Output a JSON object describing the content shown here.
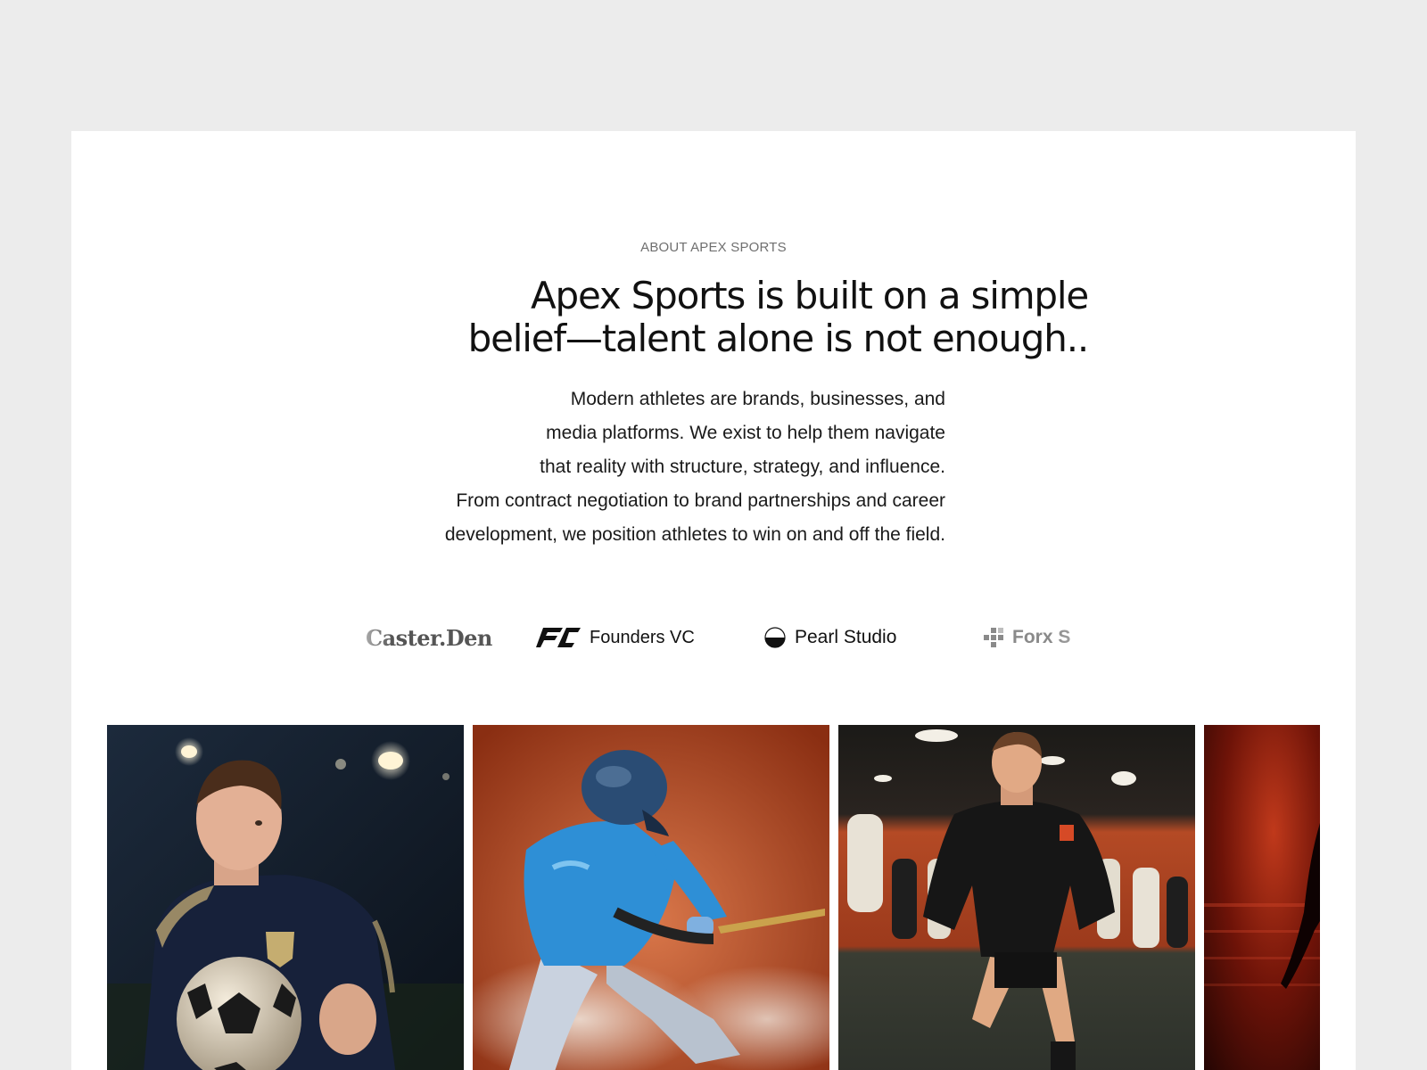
{
  "about": {
    "eyebrow": "ABOUT APEX SPORTS",
    "headline_lines": [
      "Apex Sports is built on a simple",
      "belief—talent alone is not enough.."
    ],
    "body_lines": [
      "Modern athletes are brands, businesses, and",
      "media platforms. We exist to help them navigate",
      "that reality with structure, strategy, and influence.",
      "From contract negotiation to brand partnerships and career",
      "development, we position athletes to win on and off the field."
    ]
  },
  "partners": [
    {
      "name": "Caster.Den",
      "icon": "none"
    },
    {
      "name": "Founders VC",
      "icon": "fc-monogram-icon"
    },
    {
      "name": "Pearl Studio",
      "icon": "half-circle-icon"
    },
    {
      "name": "Forx S",
      "icon": "pixel-grid-icon"
    }
  ],
  "gallery": [
    {
      "subject": "soccer player holding ball at night",
      "palette": [
        "#0f1a28",
        "#1d2b3f"
      ]
    },
    {
      "subject": "baseball batter sliding on clay",
      "palette": [
        "#a4401c",
        "#d06a3c"
      ]
    },
    {
      "subject": "footballer running in indoor training",
      "palette": [
        "#1d1b18",
        "#b24421"
      ]
    },
    {
      "subject": "athlete silhouette in red light",
      "palette": [
        "#2a0705",
        "#8a1c0c"
      ]
    }
  ]
}
